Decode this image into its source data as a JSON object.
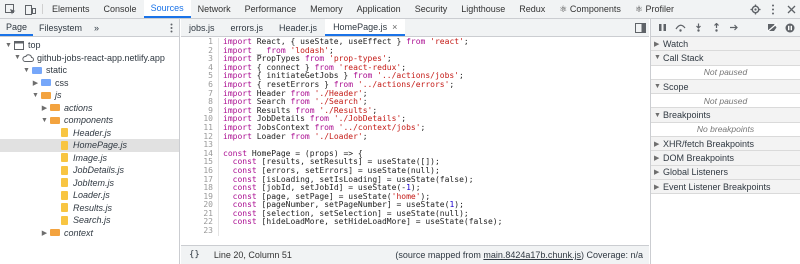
{
  "topbar": {
    "tabs": [
      {
        "label": "Elements"
      },
      {
        "label": "Console"
      },
      {
        "label": "Sources",
        "active": true
      },
      {
        "label": "Network"
      },
      {
        "label": "Performance"
      },
      {
        "label": "Memory"
      },
      {
        "label": "Application"
      },
      {
        "label": "Security"
      },
      {
        "label": "Lighthouse"
      },
      {
        "label": "Redux"
      },
      {
        "label": "⚛ Components"
      },
      {
        "label": "⚛ Profiler"
      }
    ]
  },
  "navigator": {
    "tabs": [
      "Page",
      "Filesystem"
    ],
    "more": "»",
    "tree": [
      {
        "label": "top",
        "indent": 0,
        "tri": "▼",
        "icon": "frame"
      },
      {
        "label": "github-jobs-react-app.netlify.app",
        "indent": 1,
        "tri": "▼",
        "icon": "cloud"
      },
      {
        "label": "static",
        "indent": 2,
        "tri": "▼",
        "icon": "folder-blue"
      },
      {
        "label": "css",
        "indent": 3,
        "tri": "▶",
        "icon": "folder-blue"
      },
      {
        "label": "js",
        "indent": 3,
        "tri": "▼",
        "icon": "folder-orange",
        "italic": true
      },
      {
        "label": "actions",
        "indent": 4,
        "tri": "▶",
        "icon": "folder-orange",
        "italic": true
      },
      {
        "label": "components",
        "indent": 4,
        "tri": "▼",
        "icon": "folder-orange",
        "italic": true
      },
      {
        "label": "Header.js",
        "indent": 5,
        "tri": "",
        "icon": "file-js",
        "italic": true
      },
      {
        "label": "HomePage.js",
        "indent": 5,
        "tri": "",
        "icon": "file-js",
        "italic": true,
        "selected": true
      },
      {
        "label": "Image.js",
        "indent": 5,
        "tri": "",
        "icon": "file-js",
        "italic": true
      },
      {
        "label": "JobDetails.js",
        "indent": 5,
        "tri": "",
        "icon": "file-js",
        "italic": true
      },
      {
        "label": "JobItem.js",
        "indent": 5,
        "tri": "",
        "icon": "file-js",
        "italic": true
      },
      {
        "label": "Loader.js",
        "indent": 5,
        "tri": "",
        "icon": "file-js",
        "italic": true
      },
      {
        "label": "Results.js",
        "indent": 5,
        "tri": "",
        "icon": "file-js",
        "italic": true
      },
      {
        "label": "Search.js",
        "indent": 5,
        "tri": "",
        "icon": "file-js",
        "italic": true
      },
      {
        "label": "context",
        "indent": 4,
        "tri": "▶",
        "icon": "folder-orange",
        "italic": true
      }
    ]
  },
  "editor": {
    "tabs": [
      {
        "label": "jobs.js"
      },
      {
        "label": "errors.js"
      },
      {
        "label": "Header.js"
      },
      {
        "label": "HomePage.js",
        "active": true,
        "close": "×"
      }
    ],
    "lines": [
      {
        "n": "1",
        "text": "import React, { useState, useEffect } from 'react';"
      },
      {
        "n": "2",
        "text": "import _ from 'lodash';"
      },
      {
        "n": "3",
        "text": "import PropTypes from 'prop-types';"
      },
      {
        "n": "4",
        "text": "import { connect } from 'react-redux';"
      },
      {
        "n": "5",
        "text": "import { initiateGetJobs } from '../actions/jobs';"
      },
      {
        "n": "6",
        "text": "import { resetErrors } from '../actions/errors';"
      },
      {
        "n": "7",
        "text": "import Header from './Header';"
      },
      {
        "n": "8",
        "text": "import Search from './Search';"
      },
      {
        "n": "9",
        "text": "import Results from './Results';"
      },
      {
        "n": "10",
        "text": "import JobDetails from './JobDetails';"
      },
      {
        "n": "11",
        "text": "import JobsContext from '../context/jobs';"
      },
      {
        "n": "12",
        "text": "import Loader from './Loader';"
      },
      {
        "n": "13",
        "text": ""
      },
      {
        "n": "14",
        "text": "const HomePage = (props) => {"
      },
      {
        "n": "15",
        "text": "  const [results, setResults] = useState([]);"
      },
      {
        "n": "16",
        "text": "  const [errors, setErrors] = useState(null);"
      },
      {
        "n": "17",
        "text": "  const [isLoading, setIsLoading] = useState(false);"
      },
      {
        "n": "18",
        "text": "  const [jobId, setJobId] = useState(-1);"
      },
      {
        "n": "19",
        "text": "  const [page, setPage] = useState('home');"
      },
      {
        "n": "20",
        "text": "  const [pageNumber, setPageNumber] = useState(1);"
      },
      {
        "n": "21",
        "text": "  const [selection, setSelection] = useState(null);"
      },
      {
        "n": "22",
        "text": "  const [hideLoadMore, setHideLoadMore] = useState(false);"
      },
      {
        "n": "23",
        "text": ""
      }
    ],
    "status": {
      "braces": "{}",
      "position": "Line 20, Column 51",
      "source_prefix": "(source mapped from ",
      "source_file": "main.8424a17b.chunk.js",
      "source_suffix": ") Coverage: n/a"
    }
  },
  "debugger": {
    "sections": [
      {
        "label": "Watch",
        "tri": "▶"
      },
      {
        "label": "Call Stack",
        "tri": "▼",
        "pane": "Not paused"
      },
      {
        "label": "Scope",
        "tri": "▼",
        "pane": "Not paused"
      },
      {
        "label": "Breakpoints",
        "tri": "▼",
        "pane": "No breakpoints"
      },
      {
        "label": "XHR/fetch Breakpoints",
        "tri": "▶"
      },
      {
        "label": "DOM Breakpoints",
        "tri": "▶"
      },
      {
        "label": "Global Listeners",
        "tri": "▶"
      },
      {
        "label": "Event Listener Breakpoints",
        "tri": "▶"
      }
    ]
  }
}
